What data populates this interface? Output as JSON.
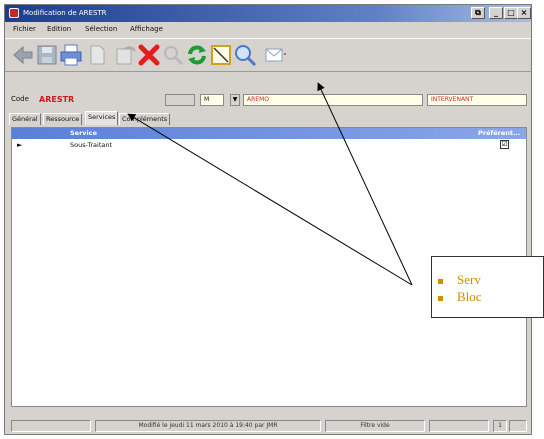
{
  "window": {
    "title": "Modification de ARESTR"
  },
  "menu": [
    "Fichier",
    "Edition",
    "Sélection",
    "Affichage"
  ],
  "toolbar_icons": [
    "back-arrow-icon",
    "save-icon",
    "print-icon",
    "document-icon",
    "undo-icon",
    "delete-icon",
    "search-icon",
    "refresh-icon",
    "edit-icon",
    "zoom-icon",
    "mail-icon"
  ],
  "record": {
    "code_label": "Code",
    "code_value": "ARESTR",
    "combo_value": "M",
    "field1": "AREMO",
    "field2": "INTERVENANT"
  },
  "tabs": [
    "Général",
    "Ressource",
    "Services",
    "Compléments"
  ],
  "grid": {
    "headers": {
      "service": "Service",
      "preference": "Préférent..."
    },
    "rows": [
      {
        "indicator": "►",
        "service": "Sous-Traitant",
        "checked": "☑"
      }
    ]
  },
  "status": {
    "modified": "Modifié le jeudi 11 mars 2010 à 19:40 par JMR",
    "filter": "Filtre vide",
    "page": "1"
  },
  "callout": {
    "line1": "Serv",
    "line2": "Bloc"
  },
  "colors": {
    "title_bar": "#1b3d8c",
    "code_red": "#d01818",
    "callout_text": "#c99000",
    "grid_header": "#5a7fd8"
  }
}
